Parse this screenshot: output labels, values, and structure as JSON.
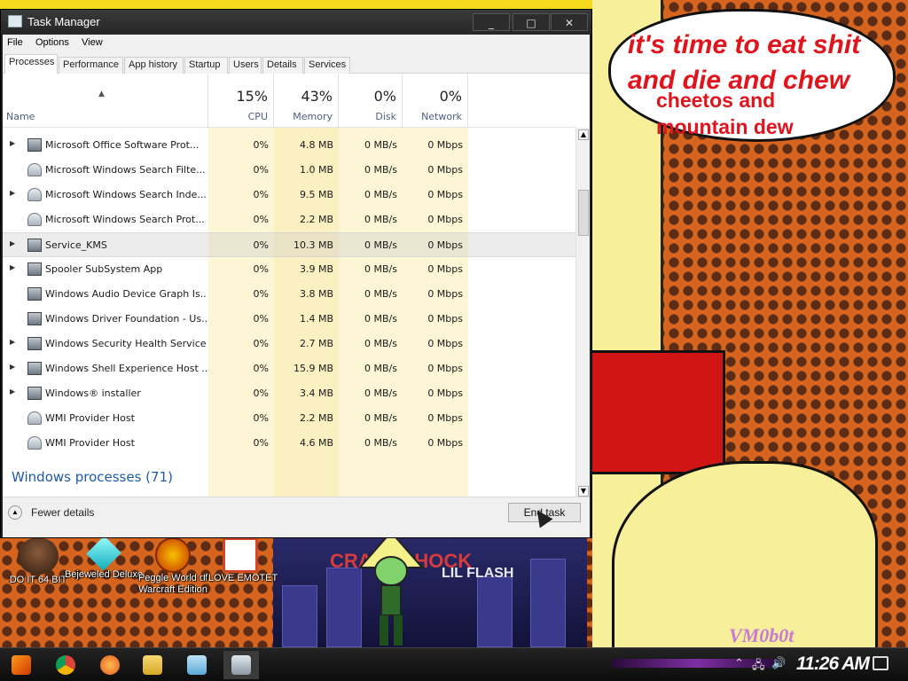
{
  "window": {
    "title": "Task Manager",
    "buttons": {
      "minimize": "_",
      "maximize": "□",
      "close": "✕"
    }
  },
  "menu": [
    "File",
    "Options",
    "View"
  ],
  "tabs": [
    "Processes",
    "Performance",
    "App history",
    "Startup",
    "Users",
    "Details",
    "Services"
  ],
  "active_tab": "Processes",
  "columns": {
    "name": {
      "label": "Name"
    },
    "cpu": {
      "pct": "15%",
      "label": "CPU"
    },
    "memory": {
      "pct": "43%",
      "label": "Memory"
    },
    "disk": {
      "pct": "0%",
      "label": "Disk"
    },
    "network": {
      "pct": "0%",
      "label": "Network"
    }
  },
  "rows": [
    {
      "name": "Microsoft Office Software Prot...",
      "cpu": "0%",
      "memory": "4.8 MB",
      "disk": "0 MB/s",
      "network": "0 Mbps",
      "expand": true
    },
    {
      "name": "Microsoft Windows Search Filte...",
      "cpu": "0%",
      "memory": "1.0 MB",
      "disk": "0 MB/s",
      "network": "0 Mbps",
      "expand": false
    },
    {
      "name": "Microsoft Windows Search Inde...",
      "cpu": "0%",
      "memory": "9.5 MB",
      "disk": "0 MB/s",
      "network": "0 Mbps",
      "expand": true
    },
    {
      "name": "Microsoft Windows Search Prot...",
      "cpu": "0%",
      "memory": "2.2 MB",
      "disk": "0 MB/s",
      "network": "0 Mbps",
      "expand": false
    },
    {
      "name": "Service_KMS",
      "cpu": "0%",
      "memory": "10.3 MB",
      "disk": "0 MB/s",
      "network": "0 Mbps",
      "expand": true,
      "selected": true
    },
    {
      "name": "Spooler SubSystem App",
      "cpu": "0%",
      "memory": "3.9 MB",
      "disk": "0 MB/s",
      "network": "0 Mbps",
      "expand": true
    },
    {
      "name": "Windows Audio Device Graph Is...",
      "cpu": "0%",
      "memory": "3.8 MB",
      "disk": "0 MB/s",
      "network": "0 Mbps",
      "expand": false
    },
    {
      "name": "Windows Driver Foundation - Us...",
      "cpu": "0%",
      "memory": "1.4 MB",
      "disk": "0 MB/s",
      "network": "0 Mbps",
      "expand": false
    },
    {
      "name": "Windows Security Health Service",
      "cpu": "0%",
      "memory": "2.7 MB",
      "disk": "0 MB/s",
      "network": "0 Mbps",
      "expand": true
    },
    {
      "name": "Windows Shell Experience Host ...",
      "cpu": "0%",
      "memory": "15.9 MB",
      "disk": "0 MB/s",
      "network": "0 Mbps",
      "expand": true
    },
    {
      "name": "Windows® installer",
      "cpu": "0%",
      "memory": "3.4 MB",
      "disk": "0 MB/s",
      "network": "0 Mbps",
      "expand": true
    },
    {
      "name": "WMI Provider Host",
      "cpu": "0%",
      "memory": "2.2 MB",
      "disk": "0 MB/s",
      "network": "0 Mbps",
      "expand": false
    },
    {
      "name": "WMI Provider Host",
      "cpu": "0%",
      "memory": "4.6 MB",
      "disk": "0 MB/s",
      "network": "0 Mbps",
      "expand": false
    }
  ],
  "group": {
    "title": "Windows processes (71)"
  },
  "footer": {
    "fewer_details": "Fewer details",
    "end_task": "End task"
  },
  "wallpaper": {
    "bubble_line1": "it's time to eat shit",
    "bubble_line2": "and die and chew",
    "bubble_line3": "cheetos and",
    "bubble_line4": "mountain dew",
    "mark": "VM0b0t",
    "album_title": "CRAFT SHOCK",
    "album_sub": "LIL FLASH"
  },
  "desktop_icons": [
    {
      "label": "DO IT 64 BIT"
    },
    {
      "label": "Bejeweled Deluxe"
    },
    {
      "label": "Peggle World of Warcraft Edition"
    },
    {
      "label": "I LOVE EMOTET"
    }
  ],
  "taskbar": {
    "clock": "11:26 AM",
    "apps": [
      "start",
      "chrome",
      "firefox",
      "file-explorer",
      "notepad",
      "task-manager"
    ]
  },
  "colors": {
    "accent_blue": "#1e5aa8",
    "heat_cpu": "#fcf6d6",
    "heat_memory": "#fbf0c2",
    "bubble_text": "#e0141c"
  }
}
